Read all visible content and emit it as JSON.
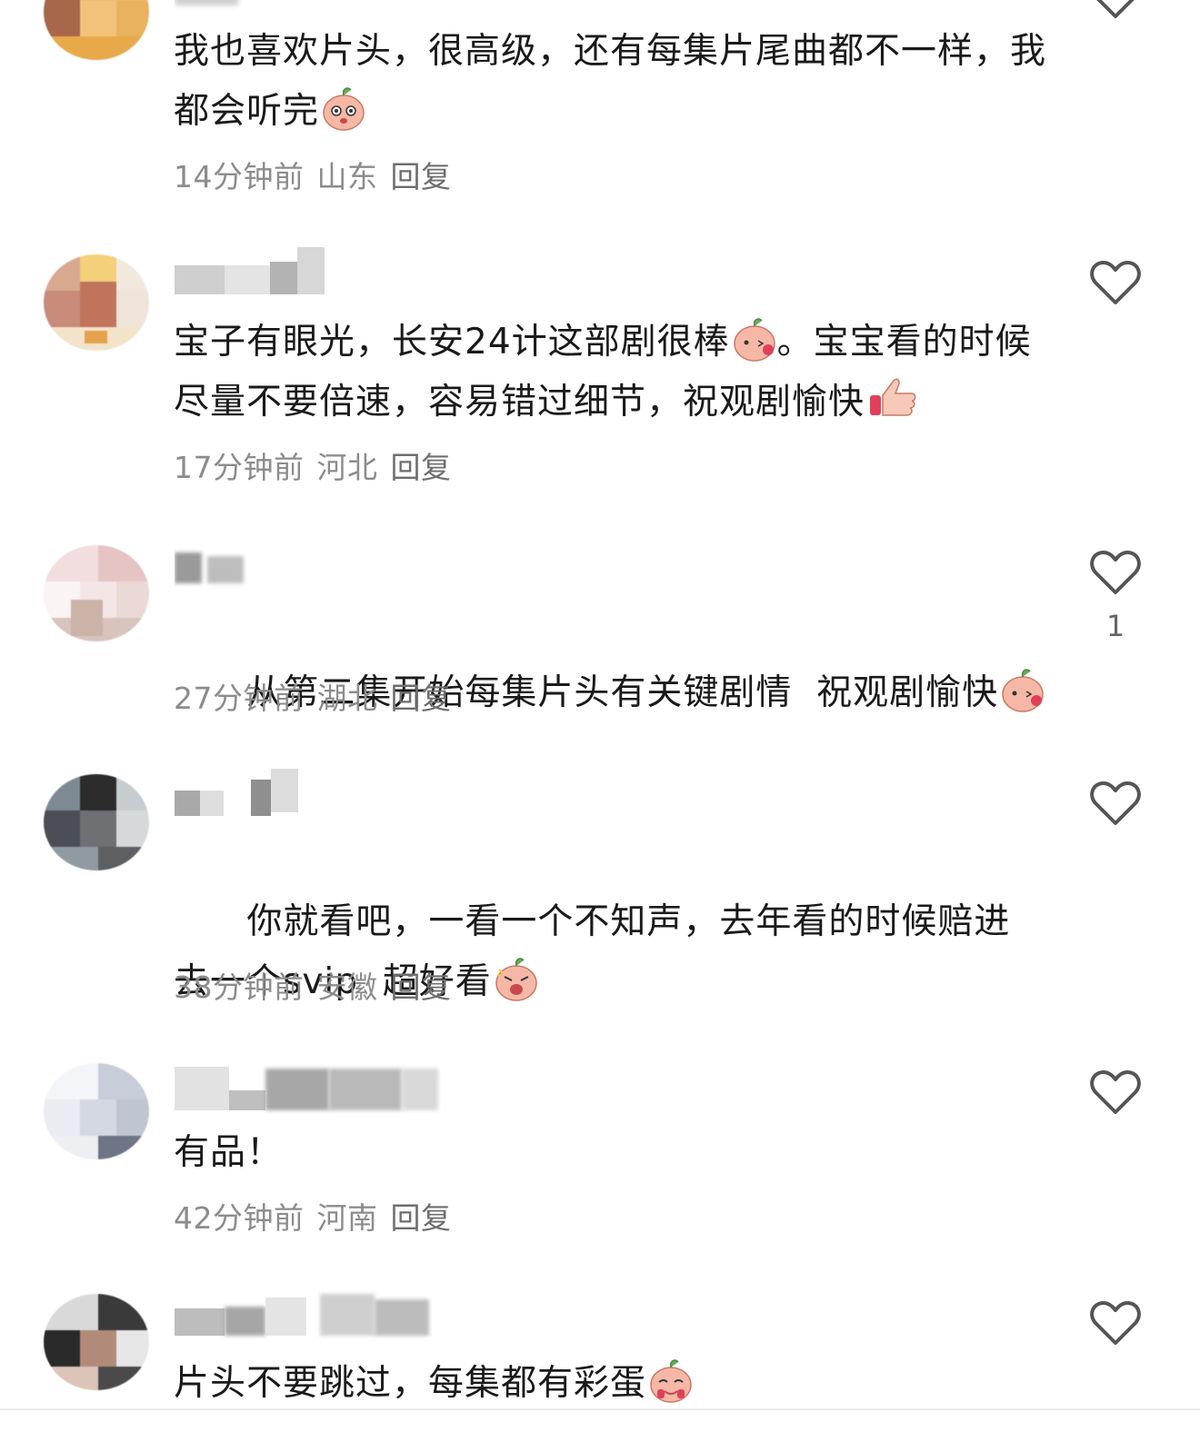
{
  "comments": [
    {
      "text": "我也喜欢片头，很高级，还有每集片尾曲都不一样，我都会听完",
      "time": "14分钟前",
      "location": "山东",
      "reply": "回复",
      "likes": ""
    },
    {
      "text": "宝子有眼光，长安24计这部剧很棒",
      "text2": "。宝宝看的时候尽量不要倍速，容易错过细节，祝观剧愉快",
      "time": "17分钟前",
      "location": "河北",
      "reply": "回复",
      "likes": ""
    },
    {
      "text": "从第二集开始每集片头有关键剧情  祝观剧愉快",
      "time": "27分钟前",
      "location": "湖北",
      "reply": "回复",
      "likes": "1"
    },
    {
      "text": "你就看吧，一看一个不知声，去年看的时候赔进去一个svip  超好看",
      "time": "38分钟前",
      "location": "安徽",
      "reply": "回复",
      "likes": ""
    },
    {
      "text": "有品！",
      "time": "42分钟前",
      "location": "河南",
      "reply": "回复",
      "likes": ""
    },
    {
      "text": "片头不要跳过，每集都有彩蛋",
      "likes": ""
    }
  ],
  "icons": {
    "like": "heart-outline-icon",
    "emoji": "peach-sticker-icon"
  },
  "colors": {
    "text": "#1a1a1a",
    "meta": "#8c8c8c",
    "icon": "#555555",
    "sticker": "#f6b8a6"
  }
}
